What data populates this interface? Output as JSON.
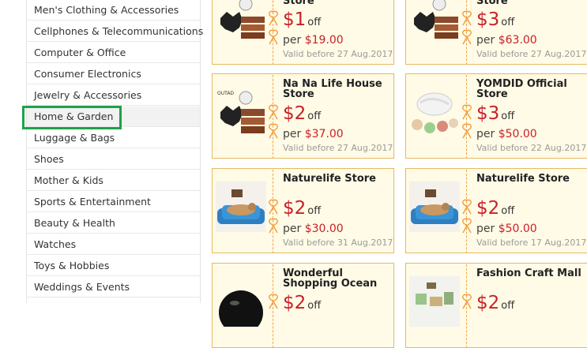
{
  "sidebar": {
    "categories": [
      {
        "label": "Men's Clothing & Accessories"
      },
      {
        "label": "Cellphones & Telecommunications"
      },
      {
        "label": "Computer & Office"
      },
      {
        "label": "Consumer Electronics"
      },
      {
        "label": "Jewelry & Accessories"
      },
      {
        "label": "Home & Garden"
      },
      {
        "label": "Luggage & Bags"
      },
      {
        "label": "Shoes"
      },
      {
        "label": "Mother & Kids"
      },
      {
        "label": "Sports & Entertainment"
      },
      {
        "label": "Beauty & Health"
      },
      {
        "label": "Watches"
      },
      {
        "label": "Toys & Hobbies"
      },
      {
        "label": "Weddings & Events"
      }
    ],
    "selected": "Home & Garden"
  },
  "coupons": [
    {
      "store": "Store",
      "amount": "$1",
      "off": "off",
      "per_label": "per",
      "min": "$19.00",
      "valid": "Valid before 27 Aug.2017"
    },
    {
      "store": "Store",
      "amount": "$3",
      "off": "off",
      "per_label": "per",
      "min": "$63.00",
      "valid": "Valid before 27 Aug.2017"
    },
    {
      "store": "Na Na Life House Store",
      "amount": "$2",
      "off": "off",
      "per_label": "per",
      "min": "$37.00",
      "valid": "Valid before 27 Aug.2017"
    },
    {
      "store": "YOMDID Official Store",
      "amount": "$3",
      "off": "off",
      "per_label": "per",
      "min": "$50.00",
      "valid": "Valid before 22 Aug.2017"
    },
    {
      "store": "Naturelife Store",
      "amount": "$2",
      "off": "off",
      "per_label": "per",
      "min": "$30.00",
      "valid": "Valid before 31 Aug.2017"
    },
    {
      "store": "Naturelife Store",
      "amount": "$2",
      "off": "off",
      "per_label": "per",
      "min": "$50.00",
      "valid": "Valid before 17 Aug.2017"
    },
    {
      "store": "Wonderful Shopping Ocean",
      "amount": "$2",
      "off": "off"
    },
    {
      "store": "Fashion Craft Mall",
      "amount": "$2",
      "off": "off"
    }
  ],
  "colors": {
    "accent": "#c9202a",
    "coupon_border": "#e7b960",
    "coupon_bg": "#fffbe6",
    "highlight": "#21a04a"
  }
}
